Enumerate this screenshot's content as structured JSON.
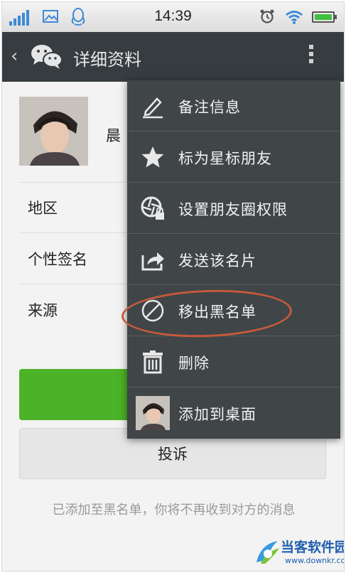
{
  "status_bar": {
    "time": "14:39",
    "icons": [
      "signal-icon",
      "gallery-icon",
      "qq-icon",
      "alarm-icon",
      "wifi-icon",
      "battery-icon"
    ]
  },
  "header": {
    "back_icon": "chevron-left-icon",
    "app_icon": "wechat-icon",
    "title": "详细资料",
    "menu_icon": "more-vertical-icon"
  },
  "profile": {
    "name": "晨",
    "rows": [
      {
        "label": "地区"
      },
      {
        "label": "个性签名"
      },
      {
        "label": "来源"
      }
    ]
  },
  "buttons": {
    "report_label": "投诉"
  },
  "notice": "已添加至黑名单，你将不再收到对方的消息",
  "menu": {
    "items": [
      {
        "label": "备注信息",
        "icon": "pencil-icon"
      },
      {
        "label": "标为星标朋友",
        "icon": "star-icon"
      },
      {
        "label": "设置朋友圈权限",
        "icon": "aperture-lock-icon"
      },
      {
        "label": "发送该名片",
        "icon": "share-icon"
      },
      {
        "label": "移出黑名单",
        "icon": "no-entry-icon"
      },
      {
        "label": "删除",
        "icon": "trash-icon"
      },
      {
        "label": "添加到桌面",
        "icon": "avatar-icon"
      }
    ]
  },
  "watermark": {
    "name": "当客软件园",
    "url": "www.downkr.com"
  },
  "colors": {
    "title_bar": "#363c40",
    "menu_bg": "#404548",
    "green_button": "#4cb227",
    "highlight_ring": "#c65a3a",
    "watermark": "#1f5fae"
  }
}
